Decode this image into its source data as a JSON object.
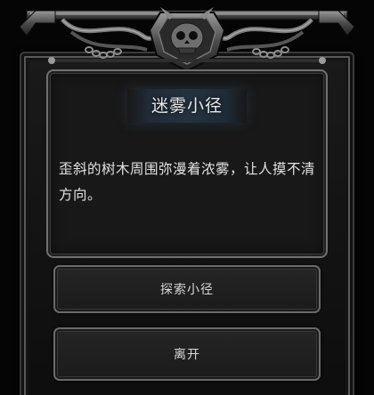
{
  "event": {
    "title": "迷雾小径",
    "description": "歪斜的树木周围弥漫着浓雾，让人摸不清方向。"
  },
  "choices": [
    {
      "label": "探索小径"
    },
    {
      "label": "离开"
    }
  ],
  "colors": {
    "background": "#050505",
    "panel": "#181818",
    "frame_metal": "#6a6a6a",
    "title_plate": "#243240",
    "text": "#e2e2e2"
  },
  "icons": [
    "ornate-crest-icon"
  ]
}
